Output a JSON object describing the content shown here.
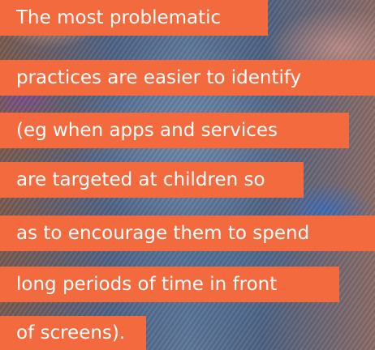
{
  "lines": [
    "The most problematic",
    "practices are easier to identify",
    "(eg when apps and services",
    "are targeted at children so",
    "as to encourage them to spend",
    "long periods of time in front",
    "of screens)."
  ],
  "colors": {
    "band": "#f26a3e",
    "text": "#ffffff"
  }
}
